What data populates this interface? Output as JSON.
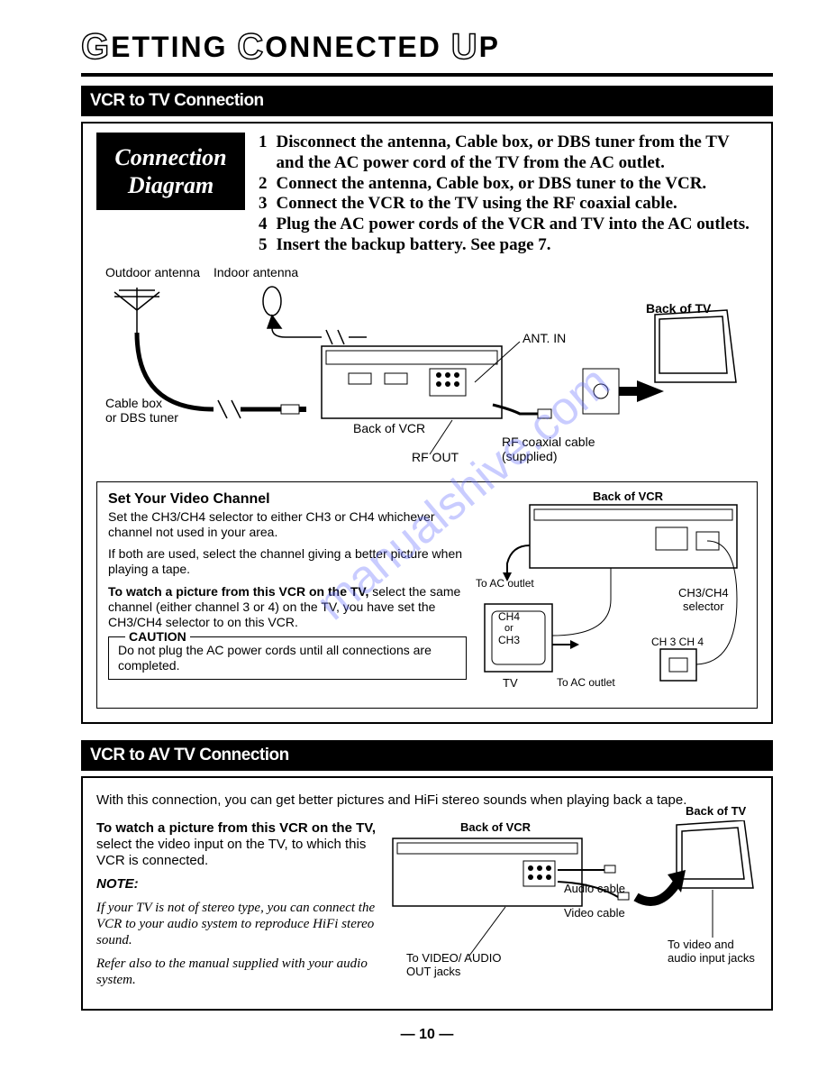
{
  "page_title": {
    "word1_cap": "G",
    "word1_rest": "ETTING",
    "word2_cap": "C",
    "word2_rest": "ONNECTED",
    "word3_cap": "U",
    "word3_rest": "P"
  },
  "section1": {
    "bar": "VCR to TV Connection",
    "chip_line1": "Connection",
    "chip_line2": "Diagram",
    "steps": [
      {
        "n": "1",
        "t": "Disconnect the antenna, Cable box, or DBS tuner from the TV and the AC power cord of the TV from the AC outlet."
      },
      {
        "n": "2",
        "t": "Connect the antenna, Cable box, or DBS tuner to the VCR."
      },
      {
        "n": "3",
        "t": "Connect the VCR to the TV using the RF coaxial cable."
      },
      {
        "n": "4",
        "t": "Plug the AC power cords of the VCR and TV into the AC outlets."
      },
      {
        "n": "5",
        "t": "Insert the backup battery. See page 7."
      }
    ],
    "diagram": {
      "outdoor_antenna": "Outdoor antenna",
      "indoor_antenna": "Indoor antenna",
      "cable_box": "Cable box\nor DBS tuner",
      "back_vcr": "Back of VCR",
      "rf_out": "RF OUT",
      "ant_in": "ANT. IN",
      "rf_cable": "RF coaxial cable\n(supplied)",
      "back_tv": "Back of TV"
    },
    "video_channel": {
      "title": "Set Your Video Channel",
      "p1": "Set the CH3/CH4 selector to either CH3 or CH4 whichever channel not used in your area.",
      "p2": "If both are used, select the channel giving a better picture when playing a tape.",
      "p3_bold": "To watch a picture from this VCR on the TV,",
      "p3_rest": " select the same channel (either channel 3 or 4) on the TV, you have set the CH3/CH4 selector to on this VCR.",
      "caution_label": "CAUTION",
      "caution_text": "Do not plug the AC power cords until all connections are completed."
    },
    "video_channel_labels": {
      "back_vcr": "Back of VCR",
      "to_ac": "To AC outlet",
      "to_ac2": "To AC outlet",
      "ch4": "CH4",
      "or": "or",
      "ch3": "CH3",
      "tv": "TV",
      "selector": "CH3/CH4\nselector",
      "switch": "CH 3  CH 4"
    }
  },
  "section2": {
    "bar": "VCR to AV TV Connection",
    "intro": "With this connection, you can get better pictures and HiFi stereo sounds when playing back a tape.",
    "watch_bold": "To watch a picture from this VCR on the TV,",
    "watch_rest": " select the video input on the TV, to which this VCR is connected.",
    "note_label": "NOTE:",
    "note1": "If your TV is not of stereo type, you can connect the VCR to your audio system to reproduce HiFi stereo sound.",
    "note2": "Refer also to the manual supplied with your audio system.",
    "labels": {
      "back_vcr": "Back of VCR",
      "back_tv": "Back of TV",
      "audio_cable": "Audio cable",
      "video_cable": "Video cable",
      "to_video_audio": "To VIDEO/ AUDIO OUT jacks",
      "to_jacks": "To video and audio input jacks"
    }
  },
  "page_number": "— 10 —",
  "watermark": "manualshive.com"
}
